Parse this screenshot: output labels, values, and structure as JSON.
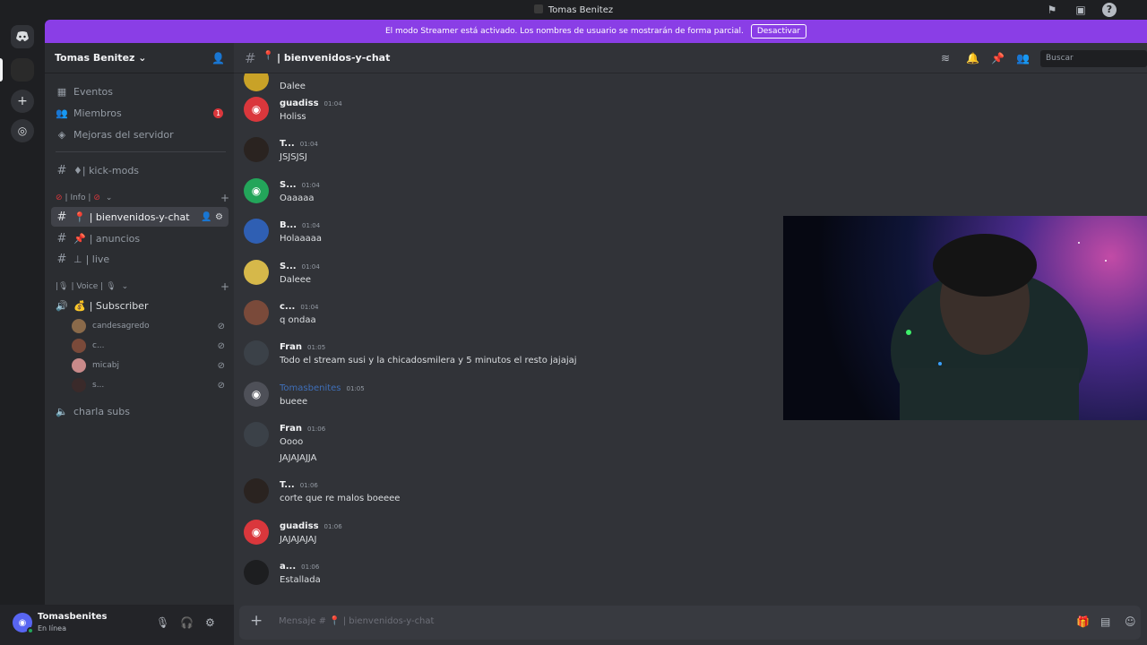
{
  "window": {
    "title": "Tomas Benitez"
  },
  "banner": {
    "text": "El modo Streamer está activado. Los nombres de usuario se mostrarán de forma parcial.",
    "button": "Desactivar"
  },
  "server": {
    "name": "Tomas Benitez ⌄",
    "top_items": [
      {
        "label": "Eventos",
        "icon": "calendar-icon"
      },
      {
        "label": "Miembros",
        "icon": "members-icon",
        "badge": "1"
      },
      {
        "label": "Mejoras del servidor",
        "icon": "boost-icon"
      }
    ],
    "channels": {
      "kick_mods": "♦| kick-mods",
      "cat_info": "| Info |",
      "bienvenidos": "| bienvenidos-y-chat",
      "anuncios": "| anuncios",
      "live": "| live",
      "cat_voice": "| Voice |",
      "subscriber": "| Subscriber",
      "charla_subs": "charla subs"
    },
    "voice_users": [
      "candesagredo",
      "c...",
      "micabj",
      "s..."
    ]
  },
  "user": {
    "name": "Tomasbenites",
    "status": "En línea"
  },
  "channel": {
    "name": "| bienvenidos-y-chat",
    "search_placeholder": "Buscar"
  },
  "messages": [
    {
      "author": "",
      "time": "",
      "text": "Dalee",
      "avatar_color": "#c9a227"
    },
    {
      "author": "guadiss",
      "time": "01:04",
      "text": "Holiss",
      "avatar_color": "#da373c"
    },
    {
      "author": "T...",
      "time": "01:04",
      "text": "JSJSJSJ",
      "avatar_color": "#2a2320"
    },
    {
      "author": "S...",
      "time": "01:04",
      "text": "Oaaaaa",
      "avatar_color": "#23a55a"
    },
    {
      "author": "B...",
      "time": "01:04",
      "text": "Holaaaaa",
      "avatar_color": "#2f5fb3"
    },
    {
      "author": "S...",
      "time": "01:04",
      "text": "Daleee",
      "avatar_color": "#d6b84a"
    },
    {
      "author": "c...",
      "time": "01:04",
      "text": "q ondaa",
      "avatar_color": "#7a4a3a"
    },
    {
      "author": "Fran",
      "time": "01:05",
      "text": "Todo el stream susi y la chicadosmilera y 5 minutos el resto jajajaj",
      "avatar_color": "#3b4148"
    },
    {
      "author": "Tomasbenites",
      "time": "01:05",
      "text": "bueee",
      "avatar_color": "#4e5058"
    },
    {
      "author": "Fran",
      "time": "01:06",
      "text": "Oooo",
      "text2": "JAJAJAJJA",
      "avatar_color": "#3b4148"
    },
    {
      "author": "T...",
      "time": "01:06",
      "text": "corte que re malos boeeee",
      "avatar_color": "#2a2320"
    },
    {
      "author": "guadiss",
      "time": "01:06",
      "text": "JAJAJAJAJ",
      "avatar_color": "#da373c"
    },
    {
      "author": "a...",
      "time": "01:06",
      "text": "Estallada",
      "avatar_color": "#1d1e20"
    }
  ],
  "composer": {
    "placeholder": "Mensaje # 📍 | bienvenidos-y-chat"
  },
  "colors": {
    "accent": "#5865f2",
    "streamer_banner": "#8a3ee6",
    "sidebar": "#2b2d31",
    "chat": "#313338"
  }
}
